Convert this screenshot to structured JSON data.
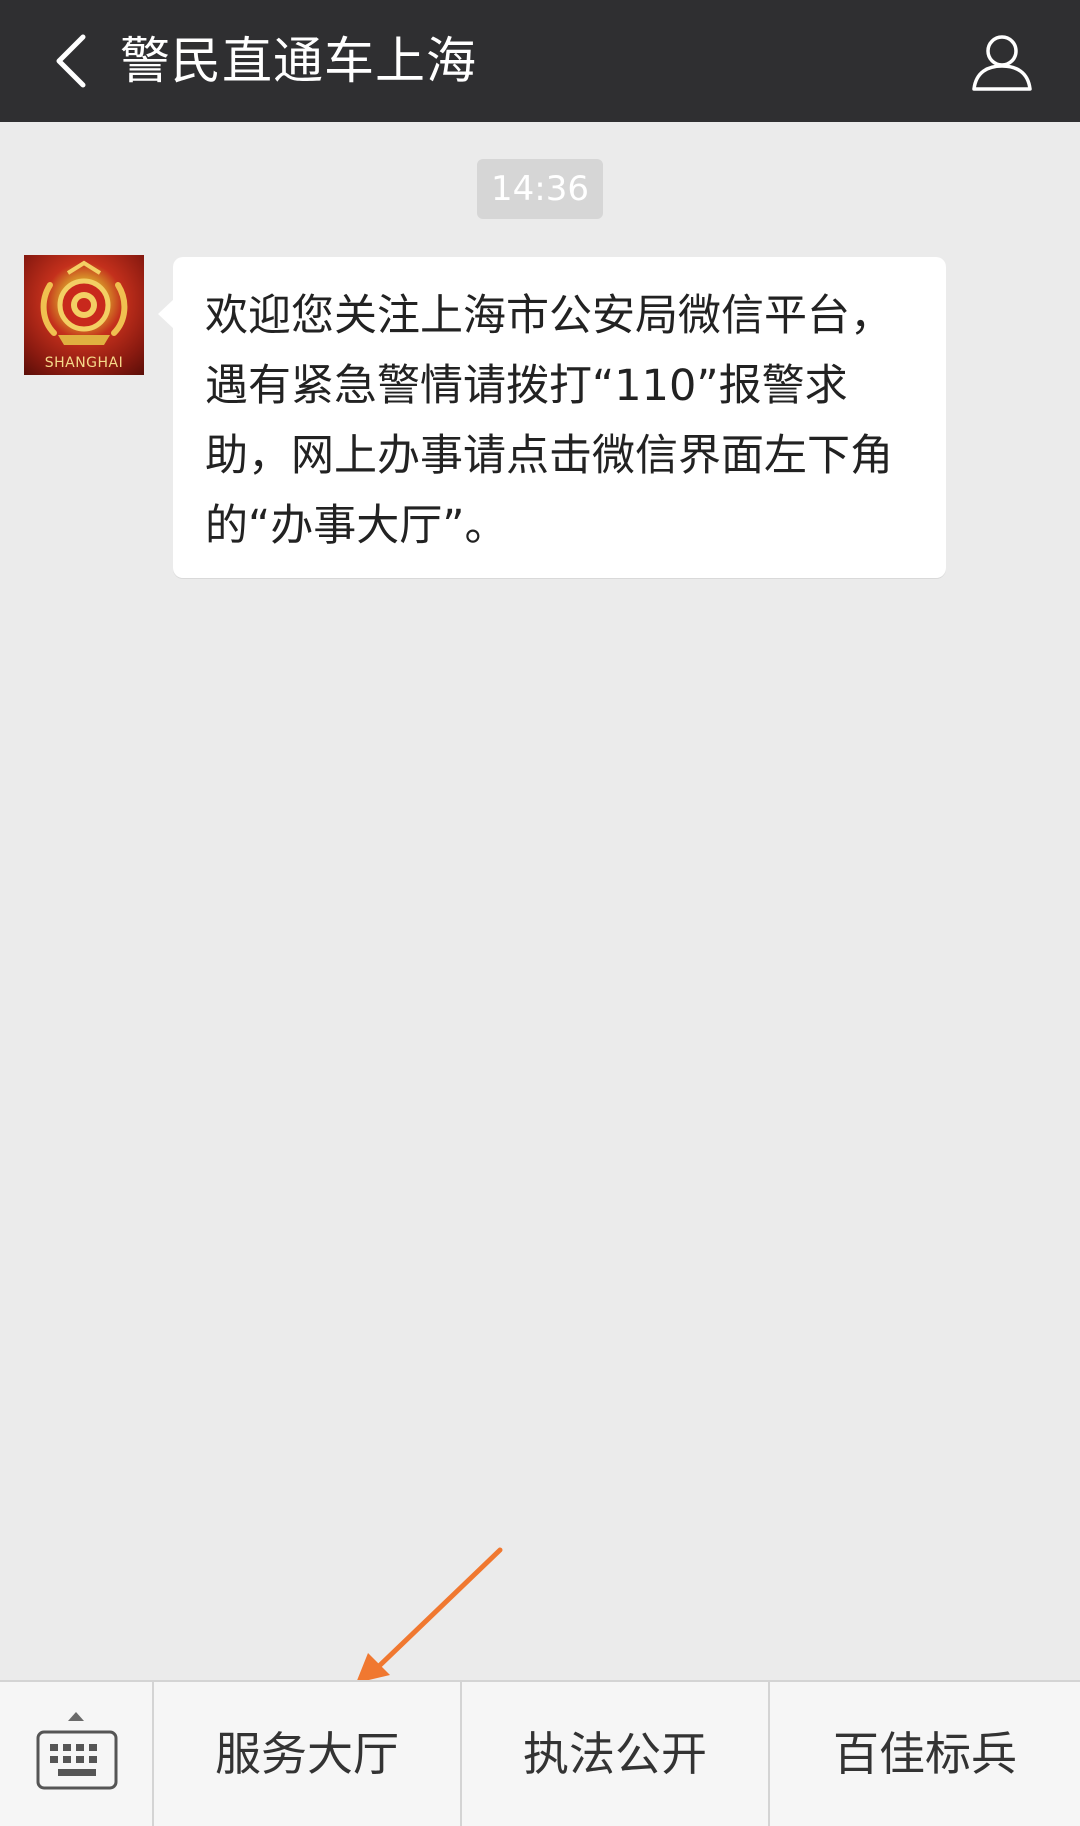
{
  "header": {
    "title": "警民直通车上海",
    "back_icon": "chevron-left-icon",
    "profile_icon": "user-icon"
  },
  "chat": {
    "timestamp": "14:36",
    "avatar_text": "SHANGHAI",
    "message": "欢迎您关注上海市公安局微信平台，遇有紧急警情请拨打“110”报警求助，网上办事请点击微信界面左下角的“办事大厅”。"
  },
  "menu": {
    "keyboard_icon": "keyboard-icon",
    "items": [
      {
        "label": "服务大厅"
      },
      {
        "label": "执法公开"
      },
      {
        "label": "百佳标兵"
      }
    ]
  },
  "colors": {
    "topbar": "#2f2f31",
    "background": "#ebebeb",
    "bubble": "#ffffff",
    "annotation_arrow": "#f07830"
  }
}
